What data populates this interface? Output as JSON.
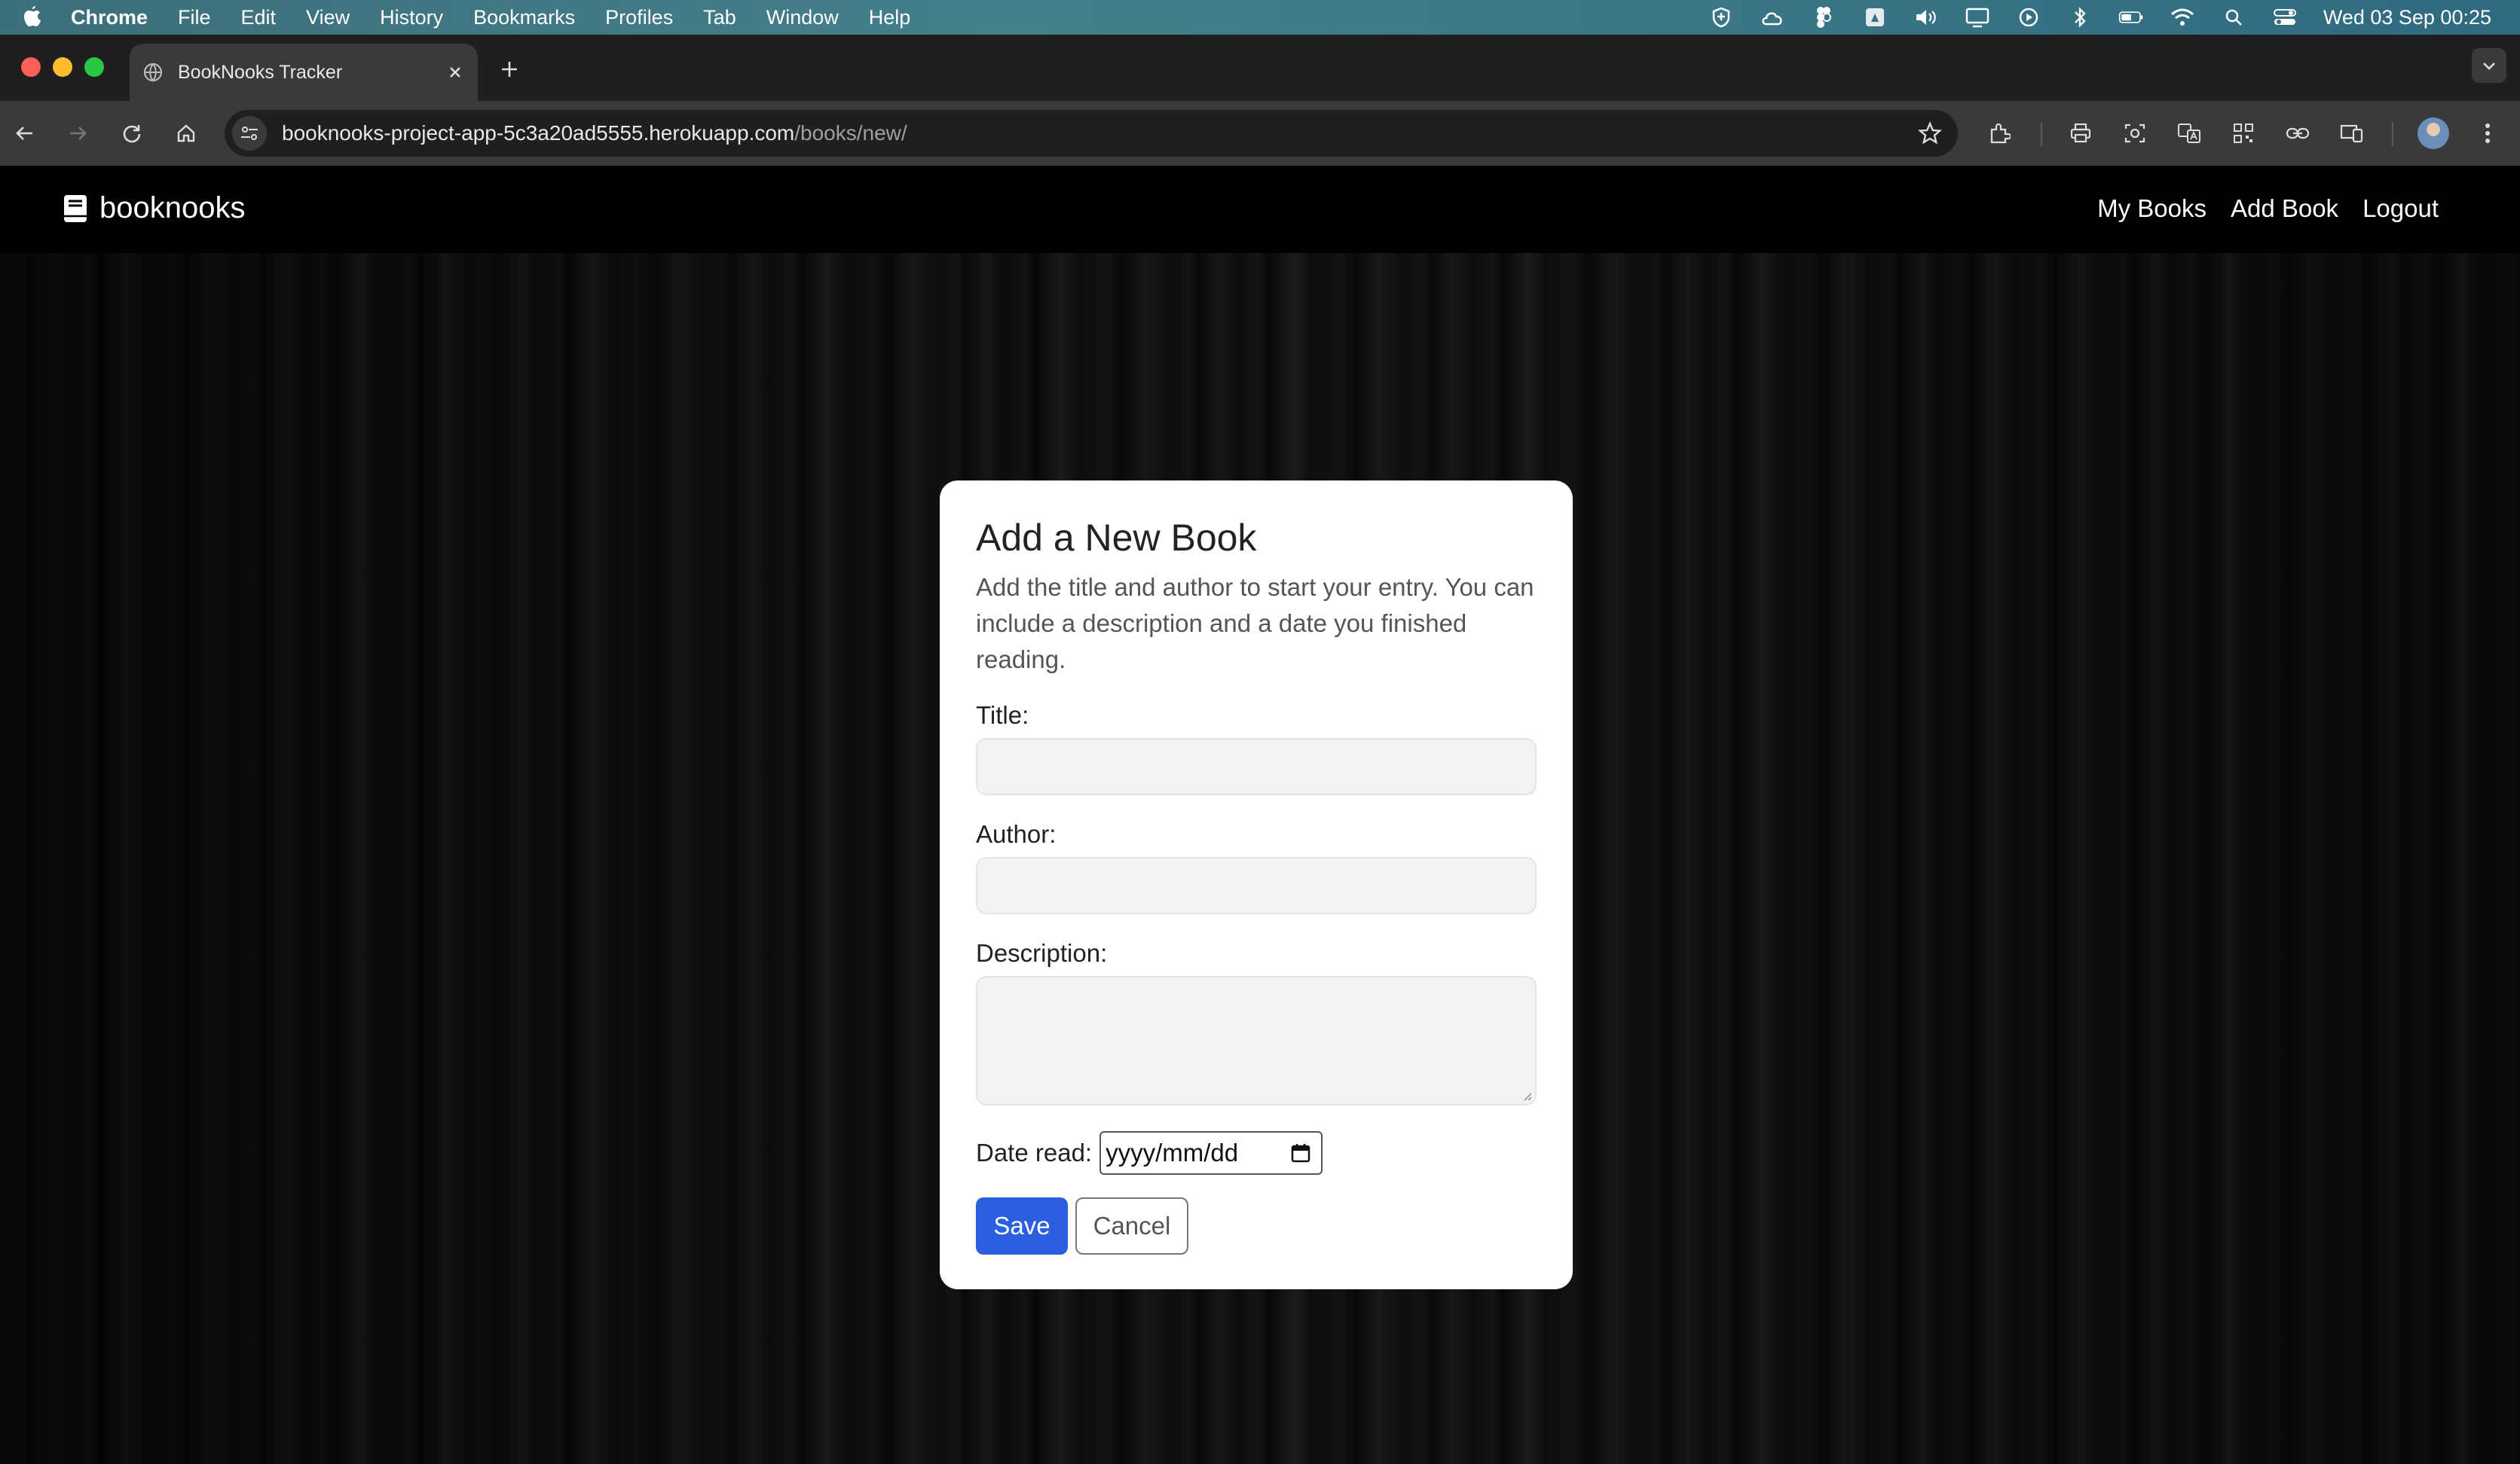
{
  "menubar": {
    "app": "Chrome",
    "items": [
      "File",
      "Edit",
      "View",
      "History",
      "Bookmarks",
      "Profiles",
      "Tab",
      "Window",
      "Help"
    ],
    "clock": "Wed 03 Sep  00:25",
    "status_icons": [
      "shield-icon",
      "cloud-icon",
      "figma-icon",
      "drive-icon",
      "volume-icon",
      "display-icon",
      "play-icon",
      "bluetooth-icon",
      "battery-icon",
      "wifi-icon",
      "spotlight-icon",
      "control-center-icon"
    ]
  },
  "browser": {
    "tab_title": "BookNooks Tracker",
    "url_host": "booknooks-project-app-5c3a20ad5555.herokuapp.com",
    "url_path": "/books/new/"
  },
  "site": {
    "brand": "booknooks",
    "nav": [
      "My Books",
      "Add Book",
      "Logout"
    ]
  },
  "form": {
    "heading": "Add a New Book",
    "intro": "Add the title and author to start your entry. You can include a description and a date you finished reading.",
    "title_label": "Title:",
    "title_value": "",
    "author_label": "Author:",
    "author_value": "",
    "description_label": "Description:",
    "description_value": "",
    "date_label": "Date read:",
    "date_placeholder": "yyyy/mm/dd",
    "save_label": "Save",
    "cancel_label": "Cancel"
  },
  "colors": {
    "accent": "#2a5fe0",
    "navbar": "#000000",
    "card": "#ffffff"
  }
}
